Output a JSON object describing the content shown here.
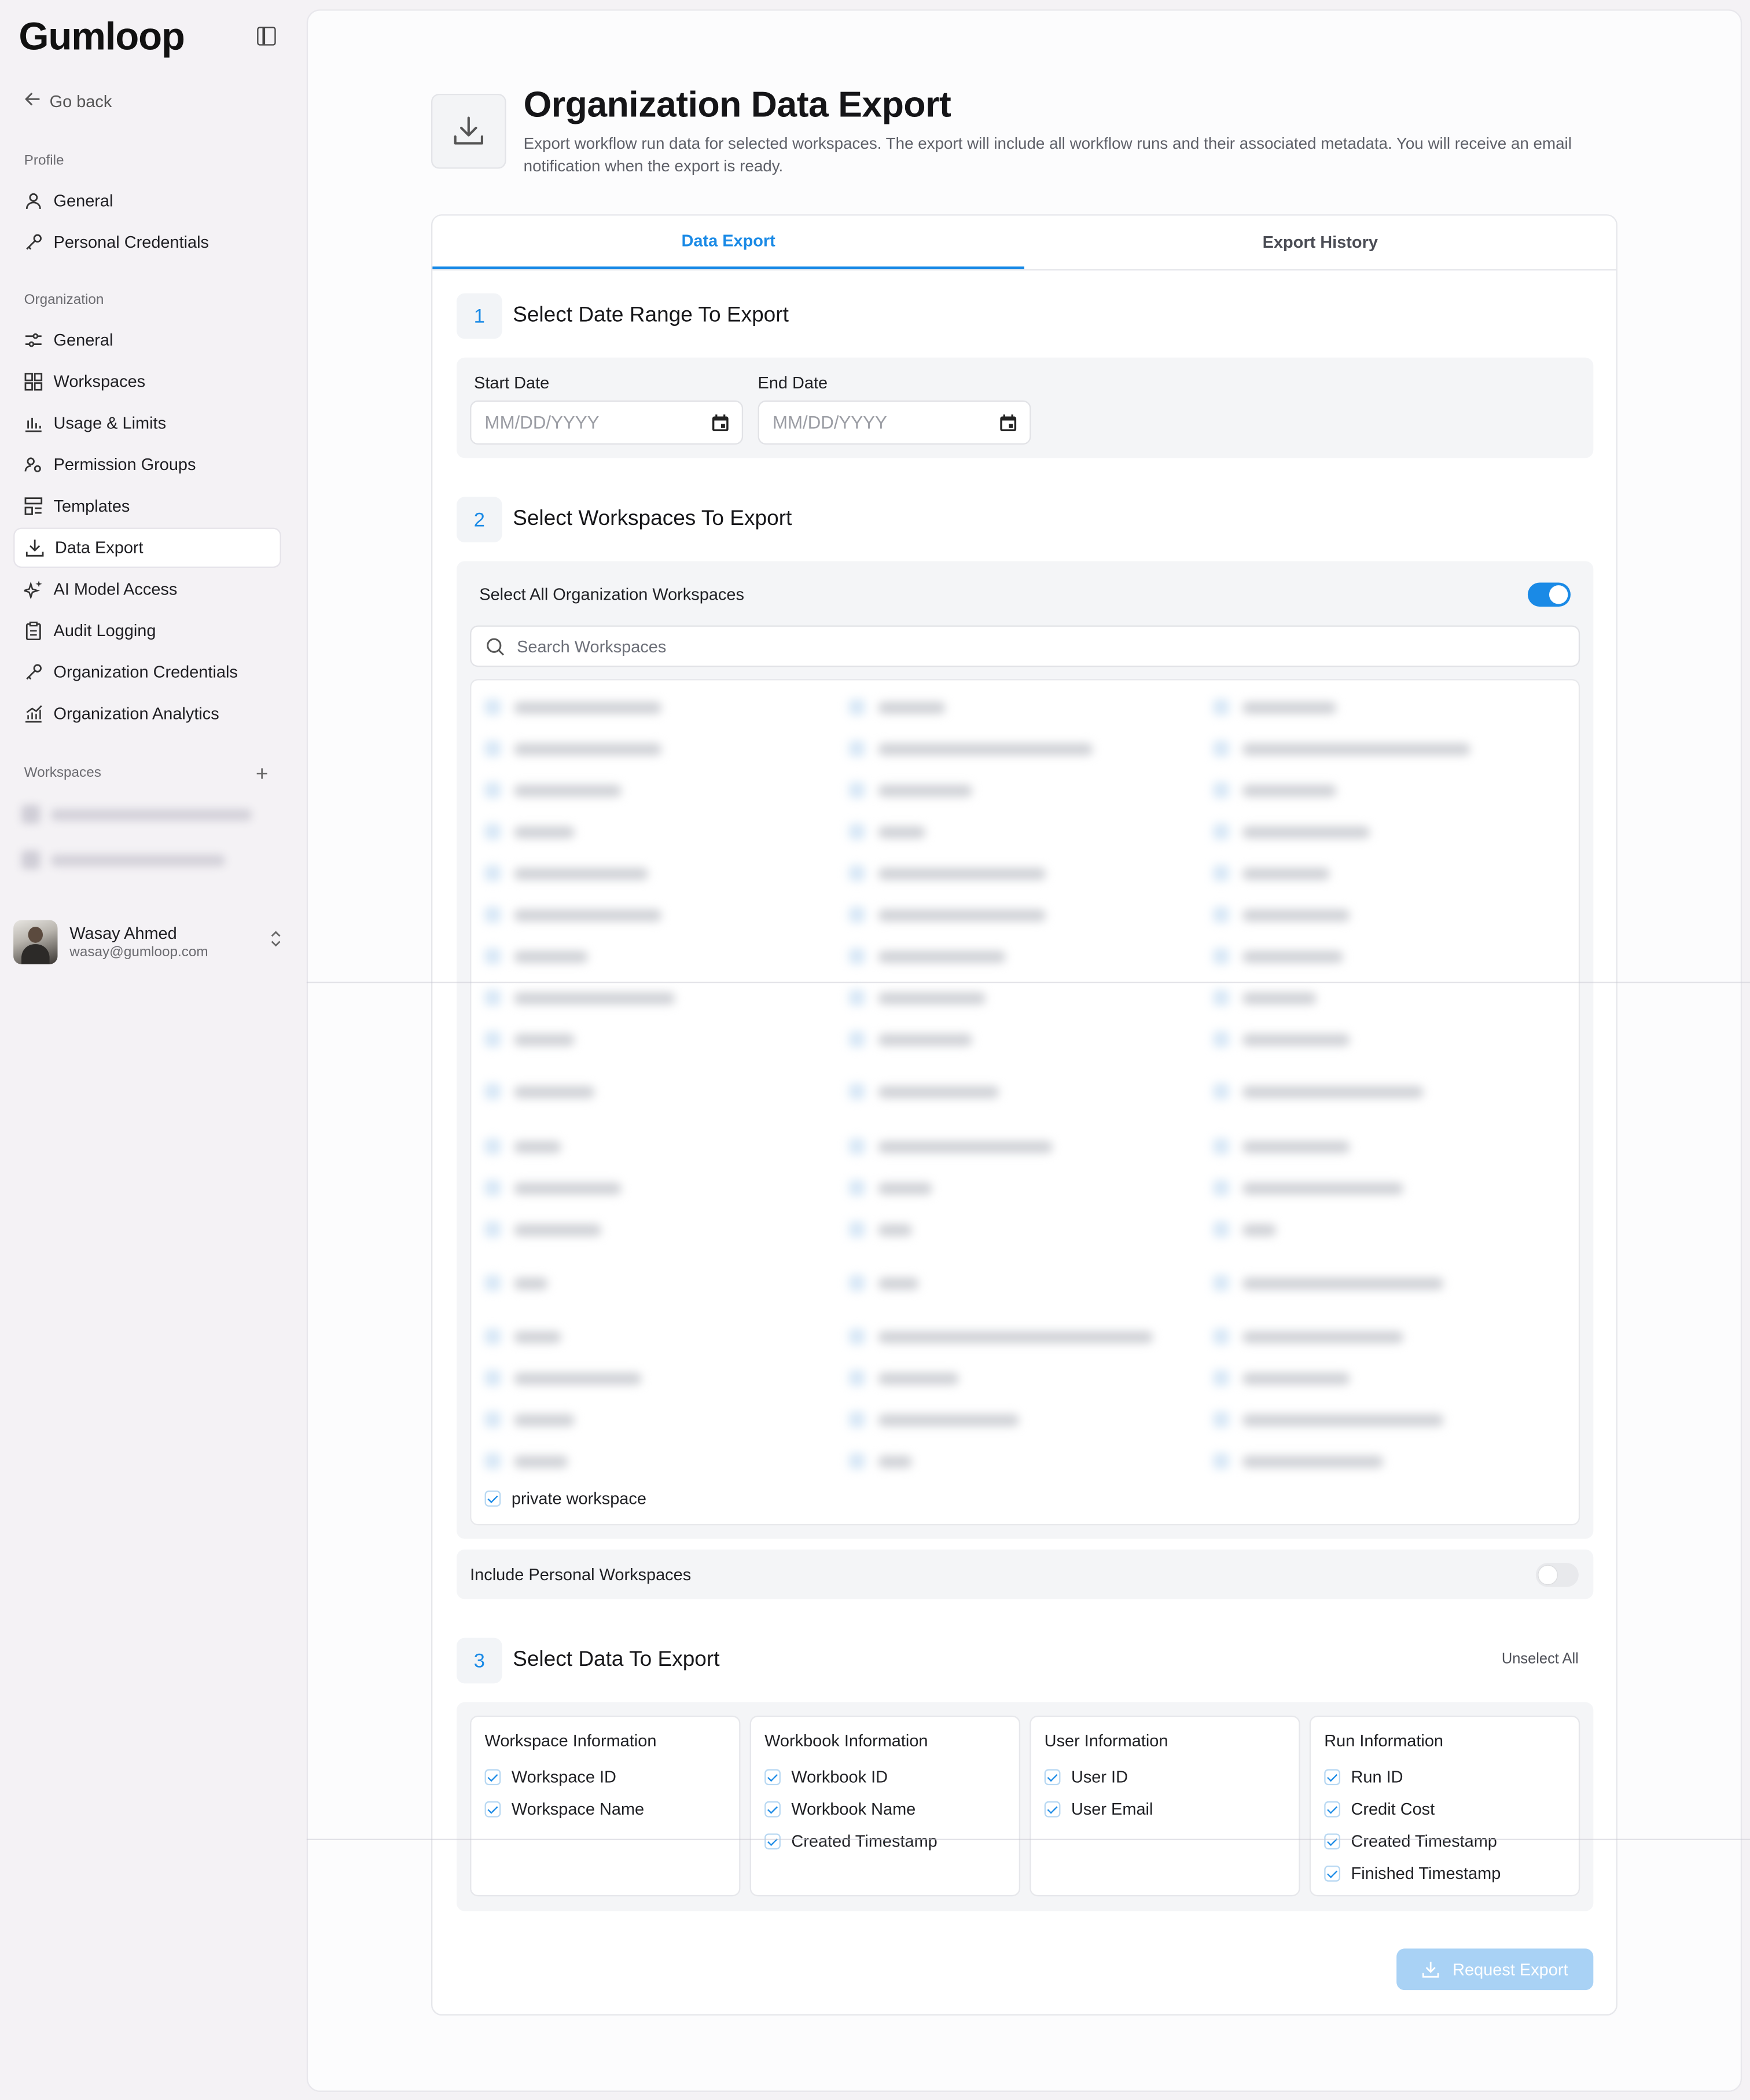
{
  "sidebar": {
    "logo": "Gumloop",
    "go_back": "Go back",
    "profile_label": "Profile",
    "profile_items": [
      {
        "label": "General",
        "icon": "user-icon"
      },
      {
        "label": "Personal Credentials",
        "icon": "key-icon"
      }
    ],
    "org_label": "Organization",
    "org_items": [
      {
        "label": "General",
        "icon": "sliders-icon"
      },
      {
        "label": "Workspaces",
        "icon": "grid-icon"
      },
      {
        "label": "Usage & Limits",
        "icon": "bar-chart-icon"
      },
      {
        "label": "Permission Groups",
        "icon": "users-icon"
      },
      {
        "label": "Templates",
        "icon": "template-icon"
      },
      {
        "label": "Data Export",
        "icon": "download-icon",
        "active": true
      },
      {
        "label": "AI Model Access",
        "icon": "sparkles-icon"
      },
      {
        "label": "Audit Logging",
        "icon": "clipboard-icon"
      },
      {
        "label": "Organization Credentials",
        "icon": "key-icon"
      },
      {
        "label": "Organization Analytics",
        "icon": "analytics-icon"
      }
    ],
    "workspaces_label": "Workspaces",
    "user": {
      "name": "Wasay Ahmed",
      "email": "wasay@gumloop.com"
    }
  },
  "header": {
    "title": "Organization Data Export",
    "description": "Export workflow run data for selected workspaces. The export will include all workflow runs and their associated metadata. You will receive an email notification when the export is ready."
  },
  "tabs": [
    {
      "label": "Data Export",
      "active": true
    },
    {
      "label": "Export History",
      "active": false
    }
  ],
  "step1": {
    "number": "1",
    "title": "Select Date Range To Export",
    "start_label": "Start Date",
    "end_label": "End Date",
    "start_placeholder": "MM/DD/YYYY",
    "end_placeholder": "MM/DD/YYYY"
  },
  "step2": {
    "number": "2",
    "title": "Select Workspaces To Export",
    "select_all_label": "Select All Organization Workspaces",
    "select_all_on": true,
    "search_placeholder": "Search Workspaces",
    "visible_workspace": "private workspace",
    "include_personal_label": "Include Personal Workspaces",
    "include_personal_on": false
  },
  "step3": {
    "number": "3",
    "title": "Select Data To Export",
    "unselect_all": "Unselect All",
    "columns": [
      {
        "title": "Workspace Information",
        "items": [
          "Workspace ID",
          "Workspace Name"
        ]
      },
      {
        "title": "Workbook Information",
        "items": [
          "Workbook ID",
          "Workbook Name",
          "Created Timestamp"
        ]
      },
      {
        "title": "User Information",
        "items": [
          "User ID",
          "User Email"
        ]
      },
      {
        "title": "Run Information",
        "items": [
          "Run ID",
          "Credit Cost",
          "Created Timestamp",
          "Finished Timestamp"
        ]
      }
    ]
  },
  "actions": {
    "request_export": "Request Export"
  },
  "colors": {
    "accent": "#1a8ae6",
    "button_disabled": "#a9d2f5"
  }
}
